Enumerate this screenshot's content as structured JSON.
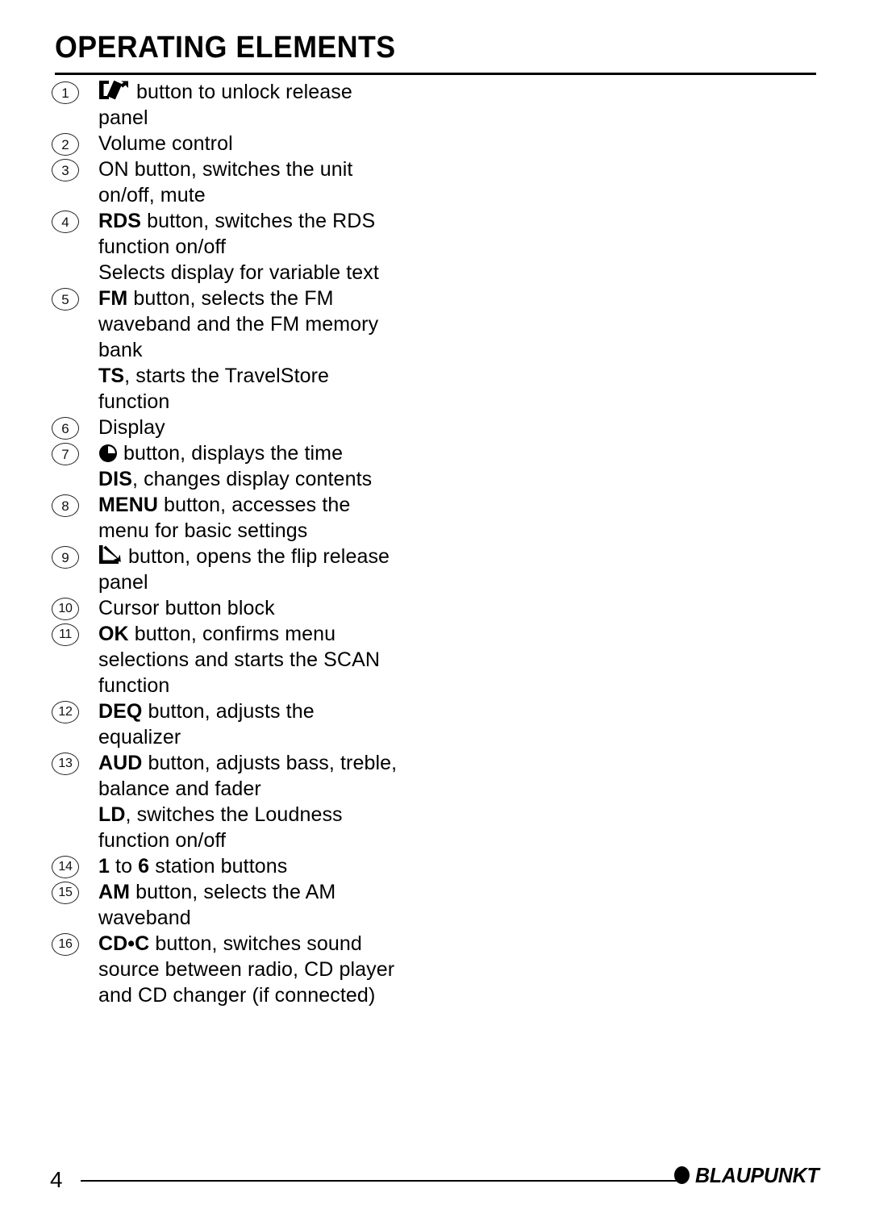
{
  "header": {
    "title": "OPERATING ELEMENTS"
  },
  "list": [
    {
      "number": "1",
      "icon": "release-panel-icon",
      "lines": [
        [
          {
            "t": "button to unlock release",
            "b": false
          }
        ],
        [
          {
            "t": "panel",
            "b": false
          }
        ]
      ]
    },
    {
      "number": "2",
      "icon": null,
      "lines": [
        [
          {
            "t": "Volume  control",
            "b": false
          }
        ]
      ]
    },
    {
      "number": "3",
      "icon": null,
      "lines": [
        [
          {
            "t": "ON button,  switches  the  unit",
            "b": false
          }
        ],
        [
          {
            "t": "on/off,  mute",
            "b": false
          }
        ]
      ]
    },
    {
      "number": "4",
      "icon": null,
      "lines": [
        [
          {
            "t": "RDS",
            "b": true
          },
          {
            "t": " button,  switches  the  RDS",
            "b": false
          }
        ],
        [
          {
            "t": "function  on/off",
            "b": false
          }
        ],
        [
          {
            "t": "Selects display for variable text",
            "b": false
          }
        ]
      ]
    },
    {
      "number": "5",
      "icon": null,
      "lines": [
        [
          {
            "t": "FM",
            "b": true
          },
          {
            "t": " button,  selects  the  FM",
            "b": false
          }
        ],
        [
          {
            "t": "waveband and the FM memory",
            "b": false
          }
        ],
        [
          {
            "t": "bank",
            "b": false
          }
        ],
        [
          {
            "t": "TS",
            "b": true
          },
          {
            "t": ", starts the TravelStore",
            "b": false
          }
        ],
        [
          {
            "t": "function",
            "b": false
          }
        ]
      ]
    },
    {
      "number": "6",
      "icon": null,
      "lines": [
        [
          {
            "t": "Display",
            "b": false
          }
        ]
      ]
    },
    {
      "number": "7",
      "icon": "clock-icon",
      "lines": [
        [
          {
            "t": "button,  displays  the  time",
            "b": false
          }
        ],
        [
          {
            "t": "DIS",
            "b": true
          },
          {
            "t": ",  changes  display  contents",
            "b": false
          }
        ]
      ]
    },
    {
      "number": "8",
      "icon": null,
      "lines": [
        [
          {
            "t": "MENU",
            "b": true
          },
          {
            "t": "  button,  accesses  the",
            "b": false
          }
        ],
        [
          {
            "t": "menu for basic settings",
            "b": false
          }
        ]
      ]
    },
    {
      "number": "9",
      "icon": "flip-release-icon",
      "lines": [
        [
          {
            "t": "button, opens the flip release",
            "b": false
          }
        ],
        [
          {
            "t": "panel",
            "b": false
          }
        ]
      ]
    },
    {
      "number": "10",
      "icon": null,
      "lines": [
        [
          {
            "t": "Cursor button block",
            "b": false
          }
        ]
      ]
    },
    {
      "number": "11",
      "icon": null,
      "lines": [
        [
          {
            "t": "OK",
            "b": true
          },
          {
            "t": " button, confirms menu",
            "b": false
          }
        ],
        [
          {
            "t": "selections and starts the SCAN",
            "b": false
          }
        ],
        [
          {
            "t": "function",
            "b": false
          }
        ]
      ]
    },
    {
      "number": "12",
      "icon": null,
      "lines": [
        [
          {
            "t": "DEQ",
            "b": true
          },
          {
            "t": " button, adjusts the",
            "b": false
          }
        ],
        [
          {
            "t": "equalizer",
            "b": false
          }
        ]
      ]
    },
    {
      "number": "13",
      "icon": null,
      "lines": [
        [
          {
            "t": "AUD",
            "b": true
          },
          {
            "t": " button, adjusts bass, treble,",
            "b": false
          }
        ],
        [
          {
            "t": "balance and fader",
            "b": false
          }
        ],
        [
          {
            "t": "LD",
            "b": true
          },
          {
            "t": ", switches the Loudness",
            "b": false
          }
        ],
        [
          {
            "t": "function on/off",
            "b": false
          }
        ]
      ]
    },
    {
      "number": "14",
      "icon": null,
      "lines": [
        [
          {
            "t": "1",
            "b": true
          },
          {
            "t": " to ",
            "b": false
          },
          {
            "t": "6",
            "b": true
          },
          {
            "t": " station buttons",
            "b": false
          }
        ]
      ]
    },
    {
      "number": "15",
      "icon": null,
      "lines": [
        [
          {
            "t": "AM",
            "b": true
          },
          {
            "t": " button,  selects  the  AM",
            "b": false
          }
        ],
        [
          {
            "t": "waveband",
            "b": false
          }
        ]
      ]
    },
    {
      "number": "16",
      "icon": null,
      "lines": [
        [
          {
            "t": "CD•C",
            "b": true
          },
          {
            "t": " button, switches sound",
            "b": false
          }
        ],
        [
          {
            "t": "source between radio, CD player",
            "b": false
          }
        ],
        [
          {
            "t": "and CD changer (if connected)",
            "b": false
          }
        ]
      ]
    }
  ],
  "footer": {
    "page_number": "4",
    "brand": "BLAUPUNKT"
  },
  "colors": {
    "text": "#000000",
    "rule": "#000000",
    "background": "#ffffff"
  }
}
